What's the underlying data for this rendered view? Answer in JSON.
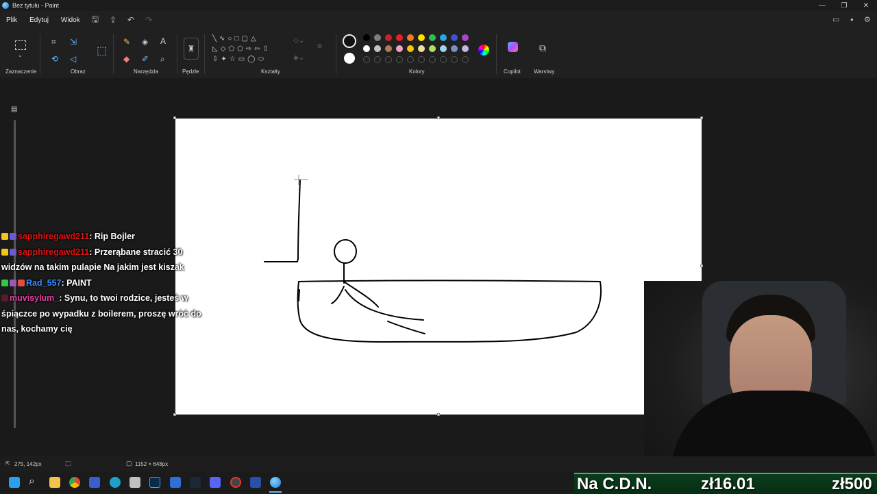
{
  "window": {
    "title": "Bez tytułu - Paint",
    "controls": [
      "—",
      "❐",
      "✕"
    ]
  },
  "menu": {
    "items": [
      "Plik",
      "Edytuj",
      "Widok"
    ]
  },
  "ribbon": {
    "groups": {
      "selection": "Zaznaczenie",
      "image": "Obraz",
      "tools": "Narzędzia",
      "brushes": "Pędzle",
      "shapes": "Kształty",
      "colors": "Kolory",
      "copilot": "Copilot",
      "layers": "Warstwy"
    },
    "colors": {
      "primary": "#111111",
      "secondary": "#ffffff",
      "row1": [
        "#000000",
        "#7f7f7f",
        "#c4242c",
        "#e8202e",
        "#f57a1f",
        "#fde300",
        "#2ebe4f",
        "#2aa5e8",
        "#3f4fd6",
        "#a44ac7"
      ],
      "row2": [
        "#ffffff",
        "#c3c3c3",
        "#b07a57",
        "#f6a1c4",
        "#fbc20f",
        "#ede29c",
        "#b3e05a",
        "#9ad8ea",
        "#7a8fc4",
        "#c6b5df"
      ]
    }
  },
  "chat": {
    "messages": [
      {
        "user": "sapphiregawd211",
        "sep": ": ",
        "text": "Rip Bojler"
      },
      {
        "user": "sapphiregawd211",
        "sep": ": ",
        "text": "Przerąbane stracić 30 widzów na takim pulapie Na jakim jest kiszak"
      },
      {
        "user": "Rad_557",
        "sep": ": ",
        "text": "PAINT"
      },
      {
        "user": "muvisylum_",
        "sep": ": ",
        "text": "Synu, to twoi rodzice, jesteś w śpiączce po wypadku z boilerem, proszę wróć do nas, kochamy cię"
      }
    ]
  },
  "status": {
    "cursor_pos": "275, 142px",
    "canvas_size": "1152 × 648px"
  },
  "donations": {
    "label": "Na C.D.N.",
    "current": "zł16.01",
    "goal": "zł500"
  },
  "accent": "#1bd15a"
}
